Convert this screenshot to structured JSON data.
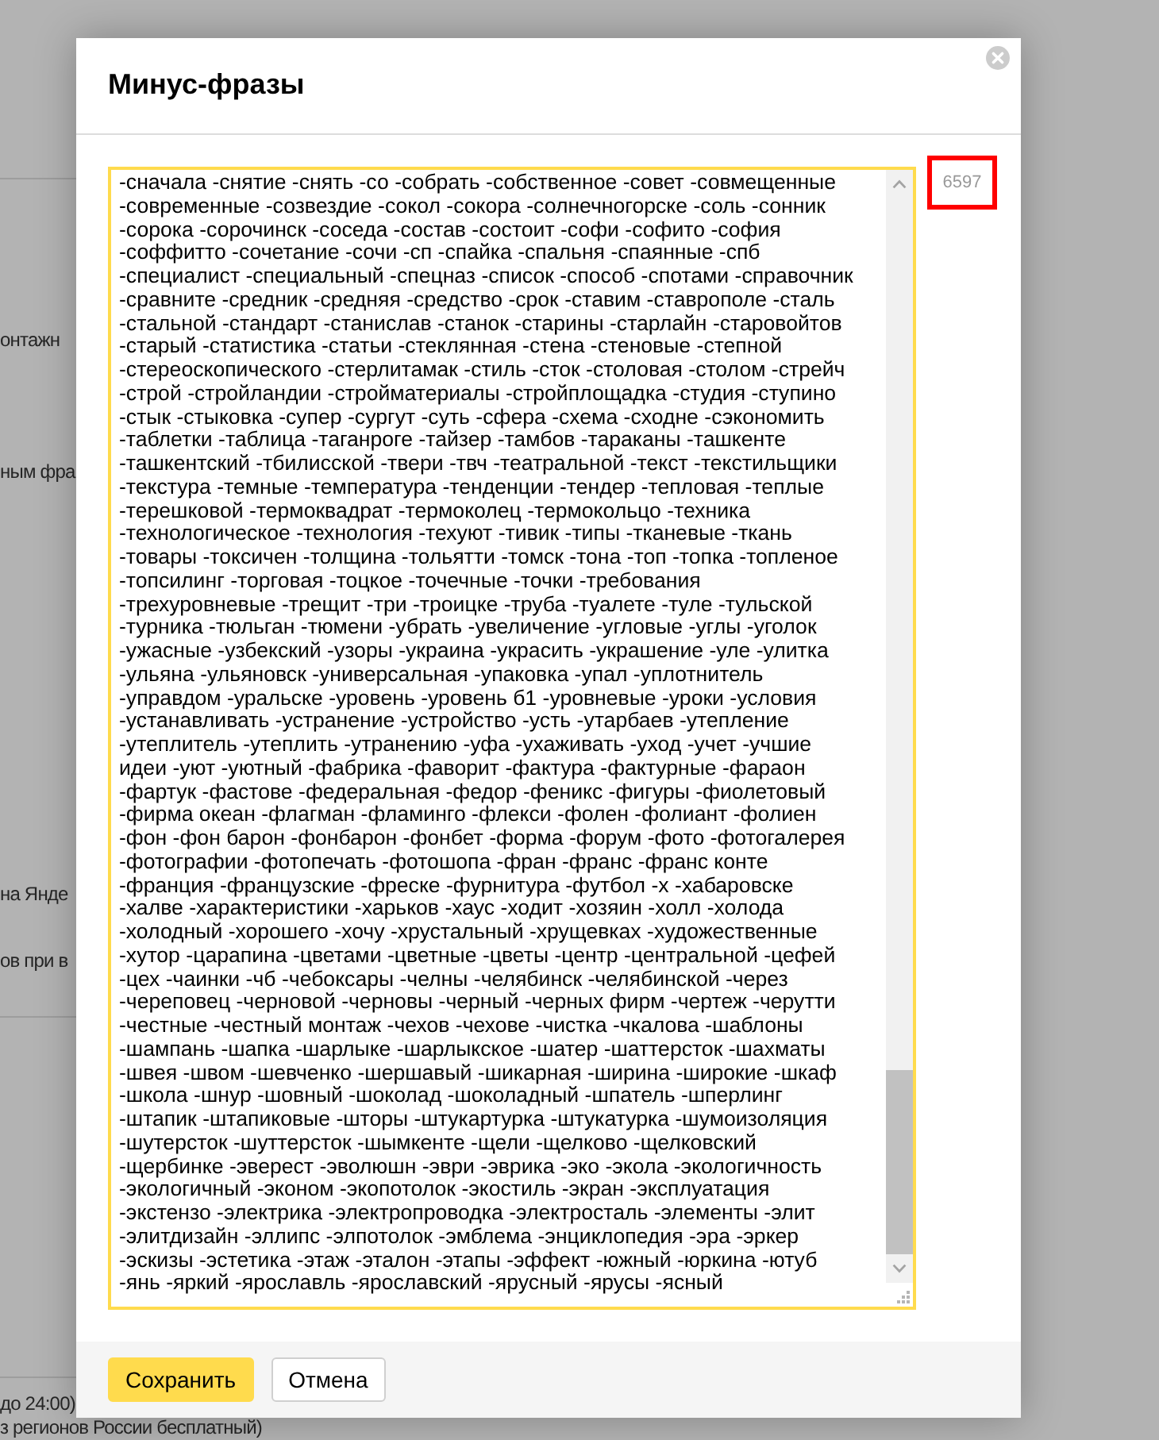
{
  "background_page": {
    "texts": [
      "онтажн",
      "ным фра",
      "на Янде",
      "ов при в",
      "до 24:00)",
      "з регионов России бесплатный)"
    ]
  },
  "dialog": {
    "title": "Минус-фразы",
    "phrases": "-сначала -снятие -снять -со -собрать -собственное -совет -совмещенные -современные -созвездие -сокол -сокора -солнечногорске -соль -сонник -сорока -сорочинск -соседа -состав -состоит -софи -софито -софия -соффитто -сочетание -сочи -сп -спайка -спальня -спаянные -спб -специалист -специальный -спецназ -список -способ -спотами -справочник -сравните -средник -средняя -средство -срок -ставим -ставрополе -сталь -стальной -стандарт -станислав -станок -старины -старлайн -старовойтов -старый -статистика -статьи -стеклянная -стена -стеновые -степной -стереоскопического -стерлитамак -стиль -сток -столовая -столом -стрейч -строй -стройландии -стройматериалы -стройплощадка -студия -ступино -стык -стыковка -супер -сургут -суть -сфера -схема -сходне -сэкономить -таблетки -таблица -таганроге -тайзер -тамбов -тараканы -ташкенте -ташкентский -тбилисской -твери -твч -театральной -текст -текстильщики -текстура -темные -температура -тенденции -тендер -тепловая -теплые -терешковой -термоквадрат -термоколец -термокольцо -техника -технологическое -технология -техуют -тивик -типы -тканевые -ткань -товары -токсичен -толщина -тольятти -томск -тона -топ -топка -топленое -топсилинг -торговая -тоцкое -точечные -точки -требования -трехуровневые -трещит -три -троицке -труба -туалете -туле -тульской -турника -тюльган -тюмени -убрать -увеличение -угловые -углы -уголок -ужасные -узбекский -узоры -украина -украсить -украшение -уле -улитка -ульяна -ульяновск -универсальная -упаковка -упал -уплотнитель -управдом -уральске -уровень -уровень б1 -уровневые -уроки -условия -устанавливать -устранение -устройство -усть -утарбаев -утепление -утеплитель -утеплить -утранению -уфа -ухаживать -уход -учет -учшие идеи -уют -уютный -фабрика -фаворит -фактура -фактурные -фараон -фартук -фастове -федеральная -федор -феникс -фигуры -фиолетовый -фирма океан -флагман -фламинго -флекси -фолен -фолиант -фолиен -фон -фон барон -фонбарон -фонбет -форма -форум -фото -фотогалерея -фотографии -фотопечать -фотошопа -фран -франс -франс конте -франция -французские -фреске -фурнитура -футбол -х -хабаровске -халве -характеристики -харьков -хаус -ходит -хозяин -холл -холода -холодный -хорошего -хочу -хрустальный -хрущевках -художественные -хутор -царапина -цветами -цветные -цветы -центр -центральной -цефей -цех -чаинки -чб -чебоксары -челны -челябинск -челябинской -через -череповец -черновой -черновы -черный -черных фирм -чертеж -черутти -честные -честный монтаж -чехов -чехове -чистка -чкалова -шаблоны -шампань -шапка -шарлыке -шарлыкское -шатер -шаттерсток -шахматы -швея -швом -шевченко -шершавый -шикарная -ширина -широкие -шкаф -школа -шнур -шовный -шоколад -шоколадный -шпатель -шперлинг -штапик -штапиковые -шторы -штукартурка -штукатурка -шумоизоляция -шутерсток -шуттерсток -шымкенте -щели -щелково -щелковский -щербинке -эверест -эволюшн -эври -эврика -эко -экола -экологичность -экологичный -эконом -экопотолок -экостиль -экран -эксплуатация -экстензо -электрика -электропроводка -электросталь -элементы -элит -элитдизайн -эллипс -элпотолок -эмблема -энциклопедия -эра -эркер -эскизы -эстетика -этаж -эталон -этапы -эффект -южный -юркина -ютуб -янь -яркий -ярославль -ярославский -ярусный -ярусы -ясный",
    "counter": {
      "text": "6597",
      "highlighted": true
    },
    "buttons": [
      {
        "label": "Сохранить",
        "kind": "primary"
      },
      {
        "label": "Отмена",
        "kind": "secondary"
      }
    ]
  }
}
